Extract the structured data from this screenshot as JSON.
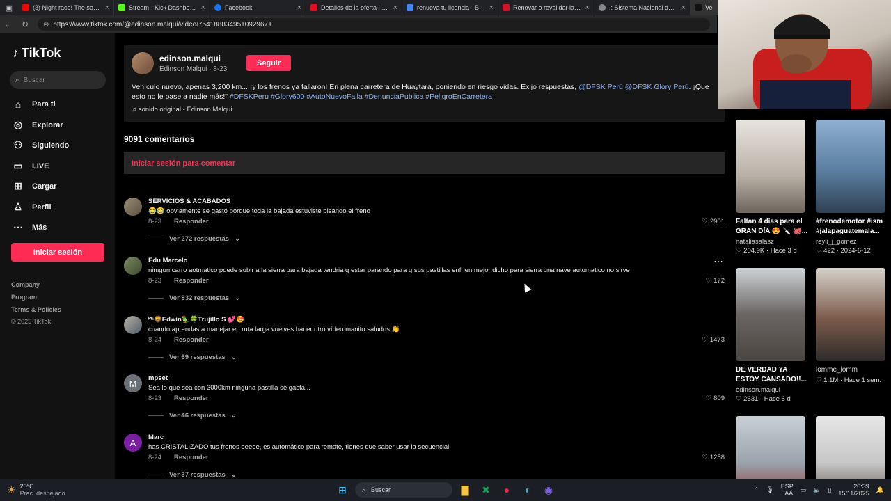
{
  "browser": {
    "tabs": [
      {
        "title": "(3) Night race! The sound o",
        "color": "#ff0000"
      },
      {
        "title": "Stream - Kick Dashboard",
        "color": "#53fc18"
      },
      {
        "title": "Facebook",
        "color": "#1877f2"
      },
      {
        "title": "Detalles de la oferta | Toyot",
        "color": "#eb0a1e"
      },
      {
        "title": "renueva tu licencia - Búsqu",
        "color": "#4285f4"
      },
      {
        "title": "Renovar o revalidar la licen",
        "color": "#d91023"
      },
      {
        "title": ".: Sistema Nacional de Con",
        "color": "#888888"
      },
      {
        "title": "Ve",
        "color": "#111111"
      }
    ],
    "url": "https://www.tiktok.com/@edinson.malqui/video/7541888349510929671"
  },
  "sidebar": {
    "logo": "TikTok",
    "search_placeholder": "Buscar",
    "nav": [
      {
        "label": "Para ti",
        "icon": "home-icon"
      },
      {
        "label": "Explorar",
        "icon": "compass-icon"
      },
      {
        "label": "Siguiendo",
        "icon": "following-icon"
      },
      {
        "label": "LIVE",
        "icon": "live-icon"
      },
      {
        "label": "Cargar",
        "icon": "upload-icon"
      },
      {
        "label": "Perfil",
        "icon": "profile-icon"
      },
      {
        "label": "Más",
        "icon": "more-icon"
      }
    ],
    "login_button": "Iniciar sesión",
    "footer": [
      "Company",
      "Program",
      "Terms & Policies",
      "© 2025 TikTok"
    ]
  },
  "post": {
    "username": "edinson.malqui",
    "meta": "Edinson Malqui · 8-23",
    "follow_button": "Seguir",
    "description_text": "Vehículo nuevo, apenas 3,200 km... ¡y los frenos ya fallaron! En plena carretera de Huaytará, poniendo en riesgo vidas. Exijo respuestas,",
    "mention1": "@DFSK Perú",
    "mention2": "@DFSK Glory Perú",
    "description_text2": ". ¡Que esto no le pase a nadie más!\"",
    "hashtags": "#DFSKPeru #Glory600 #AutoNuevoFalla #DenunciaPublica #PeligroEnCarretera",
    "sound": "♫ sonido original - Edinson Malqui"
  },
  "comments_section": {
    "count": "9091 comentarios",
    "login_prompt": "Iniciar sesión para comentar",
    "reply_label": "Responder",
    "items": [
      {
        "name": "SERVICIOS & ACABADOS",
        "text": "😂😂 obviamente se gastó porque toda la bajada estuviste pisando el freno",
        "date": "8-23",
        "likes": "2901",
        "more": "Ver 272 respuestas",
        "initial": ""
      },
      {
        "name": "Edu Marcelo",
        "text": "nimgun carro aotmatico puede subir a la sierra para bajada tendria q estar parando para q sus pastillas enfrien mejor dicho para sierra una nave automatico no sirve",
        "date": "8-23",
        "likes": "172",
        "more": "Ver 832 respuestas",
        "initial": ""
      },
      {
        "name": "ᴾᴱ🦁Edwin🦜🍀Trujillo S 💕😍",
        "text": "cuando aprendas a manejar en ruta larga vuelves hacer otro vídeo manito saludos 👏",
        "date": "8-24",
        "likes": "1473",
        "more": "Ver 69 respuestas",
        "initial": ""
      },
      {
        "name": "mpset",
        "text": "Sea lo que sea con 3000km ninguna pastilla se gasta...",
        "date": "8-23",
        "likes": "809",
        "more": "Ver 46 respuestas",
        "initial": "M"
      },
      {
        "name": "Marc",
        "text": "has CRISTALIZADO tus frenos oeeee, es automático para remate, tienes que saber usar la secuencial.",
        "date": "8-24",
        "likes": "1258",
        "more": "Ver 37 respuestas",
        "initial": "A"
      }
    ]
  },
  "recommended": [
    {
      "title": "Faltan 4 días para el GRAN DÍA 😍 🔪 🐙...",
      "user": "nataliasalasz",
      "stats": "♡ 204.9K · Hace 3 d"
    },
    {
      "title": "#frenodemotor #ism #jalapaguatemala...",
      "user": "reyli_j_gomez",
      "stats": "♡ 422 · 2024-6-12"
    },
    {
      "title": "DE VERDAD YA ESTOY CANSADO!!...",
      "user": "edinson.malqui",
      "stats": "♡ 2631 · Hace 6 d"
    },
    {
      "title": "lomme_lomm",
      "user": "",
      "stats": "♡ 1.1M · Hace 1 sem."
    }
  ],
  "taskbar": {
    "weather_temp": "20°C",
    "weather_desc": "Prac. despejado",
    "search": "Buscar",
    "lang": "ESP",
    "lang2": "LAA",
    "time": "20:39",
    "date": "15/11/2025"
  }
}
